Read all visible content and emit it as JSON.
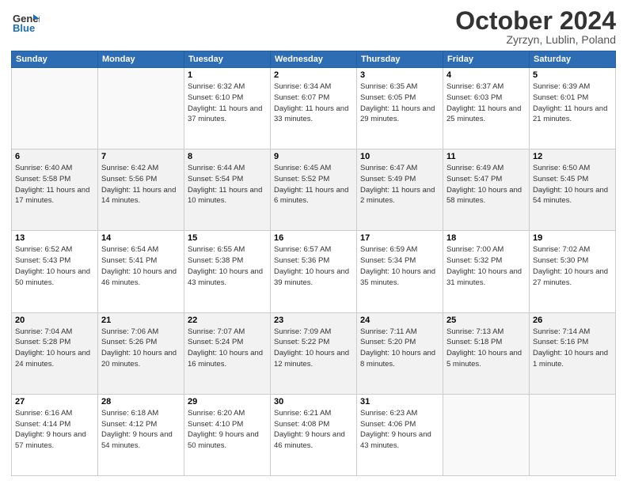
{
  "header": {
    "logo_line1": "General",
    "logo_line2": "Blue",
    "month_title": "October 2024",
    "subtitle": "Zyrzyn, Lublin, Poland"
  },
  "weekdays": [
    "Sunday",
    "Monday",
    "Tuesday",
    "Wednesday",
    "Thursday",
    "Friday",
    "Saturday"
  ],
  "weeks": [
    [
      {
        "day": "",
        "info": ""
      },
      {
        "day": "",
        "info": ""
      },
      {
        "day": "1",
        "info": "Sunrise: 6:32 AM\nSunset: 6:10 PM\nDaylight: 11 hours and 37 minutes."
      },
      {
        "day": "2",
        "info": "Sunrise: 6:34 AM\nSunset: 6:07 PM\nDaylight: 11 hours and 33 minutes."
      },
      {
        "day": "3",
        "info": "Sunrise: 6:35 AM\nSunset: 6:05 PM\nDaylight: 11 hours and 29 minutes."
      },
      {
        "day": "4",
        "info": "Sunrise: 6:37 AM\nSunset: 6:03 PM\nDaylight: 11 hours and 25 minutes."
      },
      {
        "day": "5",
        "info": "Sunrise: 6:39 AM\nSunset: 6:01 PM\nDaylight: 11 hours and 21 minutes."
      }
    ],
    [
      {
        "day": "6",
        "info": "Sunrise: 6:40 AM\nSunset: 5:58 PM\nDaylight: 11 hours and 17 minutes."
      },
      {
        "day": "7",
        "info": "Sunrise: 6:42 AM\nSunset: 5:56 PM\nDaylight: 11 hours and 14 minutes."
      },
      {
        "day": "8",
        "info": "Sunrise: 6:44 AM\nSunset: 5:54 PM\nDaylight: 11 hours and 10 minutes."
      },
      {
        "day": "9",
        "info": "Sunrise: 6:45 AM\nSunset: 5:52 PM\nDaylight: 11 hours and 6 minutes."
      },
      {
        "day": "10",
        "info": "Sunrise: 6:47 AM\nSunset: 5:49 PM\nDaylight: 11 hours and 2 minutes."
      },
      {
        "day": "11",
        "info": "Sunrise: 6:49 AM\nSunset: 5:47 PM\nDaylight: 10 hours and 58 minutes."
      },
      {
        "day": "12",
        "info": "Sunrise: 6:50 AM\nSunset: 5:45 PM\nDaylight: 10 hours and 54 minutes."
      }
    ],
    [
      {
        "day": "13",
        "info": "Sunrise: 6:52 AM\nSunset: 5:43 PM\nDaylight: 10 hours and 50 minutes."
      },
      {
        "day": "14",
        "info": "Sunrise: 6:54 AM\nSunset: 5:41 PM\nDaylight: 10 hours and 46 minutes."
      },
      {
        "day": "15",
        "info": "Sunrise: 6:55 AM\nSunset: 5:38 PM\nDaylight: 10 hours and 43 minutes."
      },
      {
        "day": "16",
        "info": "Sunrise: 6:57 AM\nSunset: 5:36 PM\nDaylight: 10 hours and 39 minutes."
      },
      {
        "day": "17",
        "info": "Sunrise: 6:59 AM\nSunset: 5:34 PM\nDaylight: 10 hours and 35 minutes."
      },
      {
        "day": "18",
        "info": "Sunrise: 7:00 AM\nSunset: 5:32 PM\nDaylight: 10 hours and 31 minutes."
      },
      {
        "day": "19",
        "info": "Sunrise: 7:02 AM\nSunset: 5:30 PM\nDaylight: 10 hours and 27 minutes."
      }
    ],
    [
      {
        "day": "20",
        "info": "Sunrise: 7:04 AM\nSunset: 5:28 PM\nDaylight: 10 hours and 24 minutes."
      },
      {
        "day": "21",
        "info": "Sunrise: 7:06 AM\nSunset: 5:26 PM\nDaylight: 10 hours and 20 minutes."
      },
      {
        "day": "22",
        "info": "Sunrise: 7:07 AM\nSunset: 5:24 PM\nDaylight: 10 hours and 16 minutes."
      },
      {
        "day": "23",
        "info": "Sunrise: 7:09 AM\nSunset: 5:22 PM\nDaylight: 10 hours and 12 minutes."
      },
      {
        "day": "24",
        "info": "Sunrise: 7:11 AM\nSunset: 5:20 PM\nDaylight: 10 hours and 8 minutes."
      },
      {
        "day": "25",
        "info": "Sunrise: 7:13 AM\nSunset: 5:18 PM\nDaylight: 10 hours and 5 minutes."
      },
      {
        "day": "26",
        "info": "Sunrise: 7:14 AM\nSunset: 5:16 PM\nDaylight: 10 hours and 1 minute."
      }
    ],
    [
      {
        "day": "27",
        "info": "Sunrise: 6:16 AM\nSunset: 4:14 PM\nDaylight: 9 hours and 57 minutes."
      },
      {
        "day": "28",
        "info": "Sunrise: 6:18 AM\nSunset: 4:12 PM\nDaylight: 9 hours and 54 minutes."
      },
      {
        "day": "29",
        "info": "Sunrise: 6:20 AM\nSunset: 4:10 PM\nDaylight: 9 hours and 50 minutes."
      },
      {
        "day": "30",
        "info": "Sunrise: 6:21 AM\nSunset: 4:08 PM\nDaylight: 9 hours and 46 minutes."
      },
      {
        "day": "31",
        "info": "Sunrise: 6:23 AM\nSunset: 4:06 PM\nDaylight: 9 hours and 43 minutes."
      },
      {
        "day": "",
        "info": ""
      },
      {
        "day": "",
        "info": ""
      }
    ]
  ]
}
